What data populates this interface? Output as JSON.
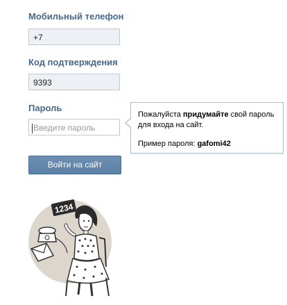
{
  "form": {
    "phone_label": "Мобильный телефон",
    "phone_value": "+7",
    "code_label": "Код подтверждения",
    "code_value": "9393",
    "password_label": "Пароль",
    "password_placeholder": "Введите пароль",
    "submit_label": "Войти на сайт"
  },
  "tooltip": {
    "text_before": "Пожалуйста ",
    "text_bold": "придумайте",
    "text_after": " свой пароль для входа на сайт.",
    "example_label": "Пример пароля: ",
    "example_value": "gafomi42"
  },
  "illustration": {
    "sign_text": "1234",
    "icon": "woman-holding-number-sign-illustration"
  },
  "colors": {
    "label": "#45688e",
    "button": "#5b7fa6",
    "input_bg": "#edf1f5"
  }
}
